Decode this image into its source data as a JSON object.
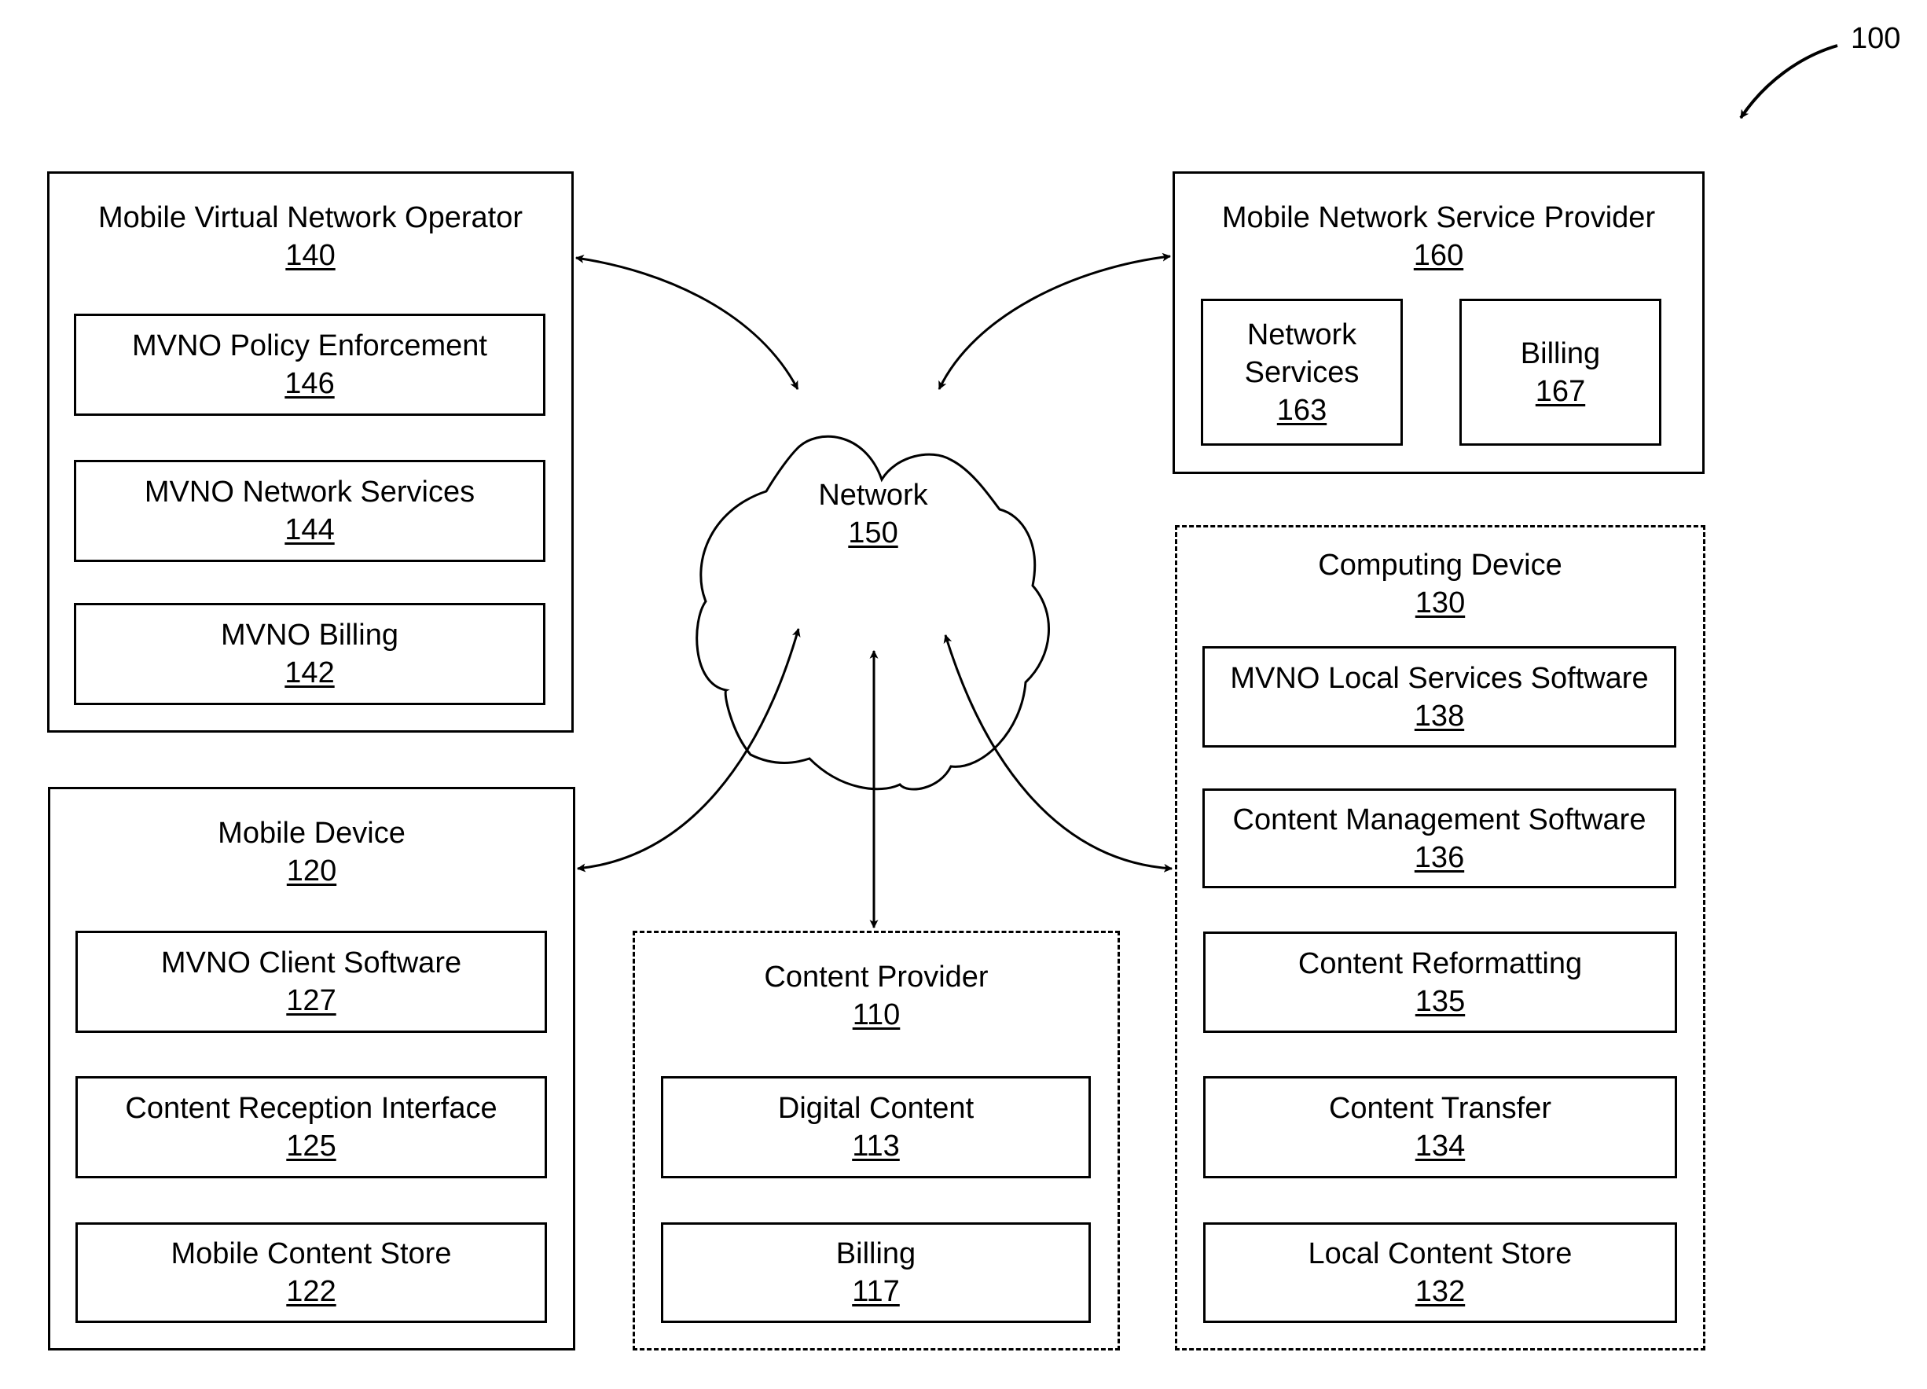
{
  "figure": {
    "ref": "100"
  },
  "network": {
    "label": "Network",
    "ref": "150"
  },
  "mvno": {
    "label": "Mobile Virtual Network Operator",
    "ref": "140",
    "components": [
      {
        "label": "MVNO Policy Enforcement",
        "ref": "146"
      },
      {
        "label": "MVNO Network Services",
        "ref": "144"
      },
      {
        "label": "MVNO Billing",
        "ref": "142"
      }
    ]
  },
  "mnsp": {
    "label": "Mobile Network Service Provider",
    "ref": "160",
    "components": [
      {
        "label_line1": "Network",
        "label_line2": "Services",
        "ref": "163"
      },
      {
        "label": "Billing",
        "ref": "167"
      }
    ]
  },
  "mobile_device": {
    "label": "Mobile Device",
    "ref": "120",
    "components": [
      {
        "label": "MVNO Client Software",
        "ref": "127"
      },
      {
        "label": "Content Reception Interface",
        "ref": "125"
      },
      {
        "label": "Mobile Content Store",
        "ref": "122"
      }
    ]
  },
  "content_provider": {
    "label": "Content Provider",
    "ref": "110",
    "components": [
      {
        "label": "Digital Content",
        "ref": "113"
      },
      {
        "label": "Billing",
        "ref": "117"
      }
    ]
  },
  "computing_device": {
    "label": "Computing Device",
    "ref": "130",
    "components": [
      {
        "label": "MVNO Local Services Software",
        "ref": "138"
      },
      {
        "label": "Content Management Software",
        "ref": "136"
      },
      {
        "label": "Content Reformatting",
        "ref": "135"
      },
      {
        "label": "Content Transfer",
        "ref": "134"
      },
      {
        "label": "Local Content Store",
        "ref": "132"
      }
    ]
  }
}
